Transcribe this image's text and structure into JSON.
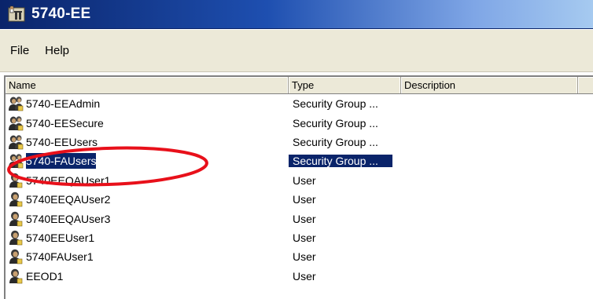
{
  "window": {
    "title": "5740-EE"
  },
  "menu": {
    "items": [
      {
        "label": "File"
      },
      {
        "label": "Help"
      }
    ]
  },
  "list": {
    "columns": [
      {
        "label": "Name"
      },
      {
        "label": "Type"
      },
      {
        "label": "Description"
      },
      {
        "label": ""
      }
    ],
    "rows": [
      {
        "name": "5740-EEAdmin",
        "type": "Security Group ...",
        "icon": "group-icon",
        "selected": false
      },
      {
        "name": "5740-EESecure",
        "type": "Security Group ...",
        "icon": "group-icon",
        "selected": false
      },
      {
        "name": "5740-EEUsers",
        "type": "Security Group ...",
        "icon": "group-icon",
        "selected": false
      },
      {
        "name": "5740-FAUsers",
        "type": "Security Group ...",
        "icon": "group-icon",
        "selected": true
      },
      {
        "name": "5740EEQAUser1",
        "type": "User",
        "icon": "user-icon",
        "selected": false
      },
      {
        "name": "5740EEQAUser2",
        "type": "User",
        "icon": "user-icon",
        "selected": false
      },
      {
        "name": "5740EEQAUser3",
        "type": "User",
        "icon": "user-icon",
        "selected": false
      },
      {
        "name": "5740EEUser1",
        "type": "User",
        "icon": "user-icon",
        "selected": false
      },
      {
        "name": "5740FAUser1",
        "type": "User",
        "icon": "user-icon",
        "selected": false
      },
      {
        "name": "EEOD1",
        "type": "User",
        "icon": "user-icon",
        "selected": false
      }
    ]
  },
  "colors": {
    "selection": "#0a246a",
    "annotation": "#e8101a"
  }
}
